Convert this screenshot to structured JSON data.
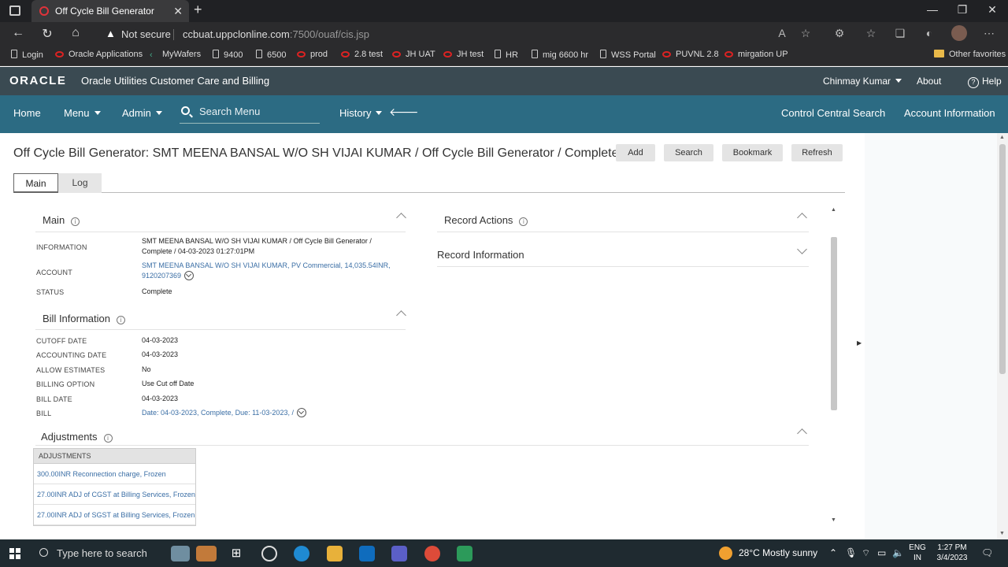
{
  "browser": {
    "tab_title": "Off Cycle Bill Generator",
    "new_tab": "+",
    "not_secure": "Not secure",
    "url_host": "ccbuat.uppclonline.com",
    "url_path": ":7500/ouaf/cis.jsp",
    "bookmarks": [
      "Login",
      "Oracle Applications",
      "MyWafers",
      "9400",
      "6500",
      "prod",
      "2.8 test",
      "JH UAT",
      "JH test",
      "HR",
      "mig 6600 hr",
      "WSS Portal",
      "PUVNL 2.8",
      "mirgation UP"
    ],
    "other_favorites": "Other favorites"
  },
  "app": {
    "logo": "ORACLE",
    "product": "Oracle Utilities Customer Care and Billing",
    "user": "Chinmay Kumar",
    "about": "About",
    "help": "Help"
  },
  "nav": {
    "home": "Home",
    "menu": "Menu",
    "admin": "Admin",
    "search_placeholder": "Search Menu",
    "history": "History",
    "control_central": "Control Central Search",
    "account_info": "Account Information"
  },
  "page": {
    "title": "Off Cycle Bill Generator: SMT MEENA BANSAL W/O SH VIJAI KUMAR / Off Cycle Bill Generator / Complete / ...",
    "buttons": {
      "add": "Add",
      "search": "Search",
      "bookmark": "Bookmark",
      "refresh": "Refresh"
    },
    "tabs": {
      "main": "Main",
      "log": "Log"
    }
  },
  "main_section": {
    "heading": "Main",
    "information_label": "INFORMATION",
    "information_value_1": "SMT MEENA BANSAL W/O SH VIJAI KUMAR / Off Cycle Bill Generator /",
    "information_value_2": "Complete / 04-03-2023 01:27:01PM",
    "account_label": "ACCOUNT",
    "account_value_1": "SMT MEENA BANSAL W/O SH VIJAI KUMAR, PV Commercial, 14,035.54INR,",
    "account_value_2": "9120207369",
    "status_label": "STATUS",
    "status_value": "Complete"
  },
  "bill_section": {
    "heading": "Bill Information",
    "rows": [
      {
        "label": "CUTOFF DATE",
        "value": "04-03-2023"
      },
      {
        "label": "ACCOUNTING DATE",
        "value": "04-03-2023"
      },
      {
        "label": "ALLOW ESTIMATES",
        "value": "No"
      },
      {
        "label": "BILLING OPTION",
        "value": "Use Cut off Date"
      },
      {
        "label": "BILL DATE",
        "value": "04-03-2023"
      }
    ],
    "bill_label": "BILL",
    "bill_value": "Date: 04-03-2023, Complete, Due: 11-03-2023, /"
  },
  "record_actions": {
    "heading": "Record Actions"
  },
  "record_information": {
    "heading": "Record Information"
  },
  "adjustments": {
    "heading": "Adjustments",
    "column": "ADJUSTMENTS",
    "rows": [
      "300.00INR Reconnection charge, Frozen",
      "27.00INR ADJ of CGST at Billing Services, Frozen",
      "27.00INR ADJ of SGST at Billing Services, Frozen"
    ]
  },
  "taskbar": {
    "search_placeholder": "Type here to search",
    "weather": "28°C  Mostly sunny",
    "lang_1": "ENG",
    "lang_2": "IN",
    "time": "1:27 PM",
    "date": "3/4/2023"
  }
}
